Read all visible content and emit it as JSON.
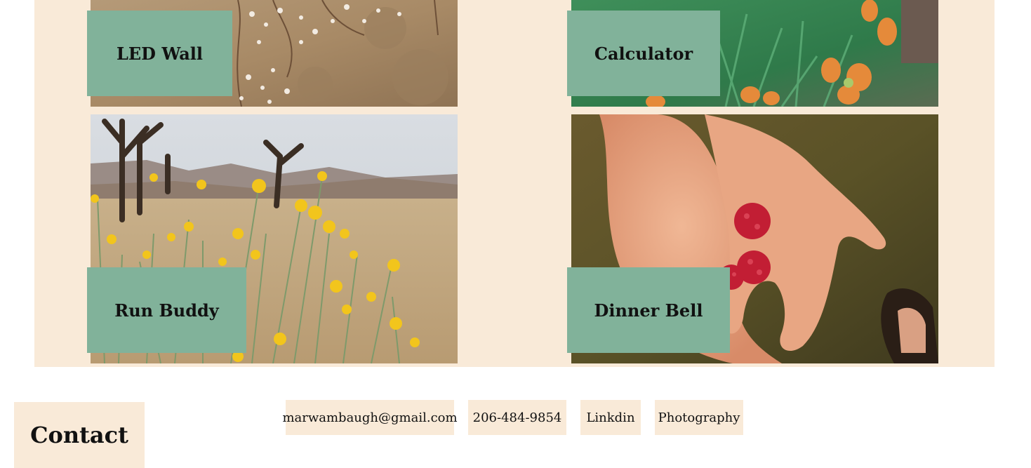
{
  "projects": [
    {
      "title": "LED Wall",
      "image": "dry-ground-with-small-white-flowers"
    },
    {
      "title": "Calculator",
      "image": "orange-wildflowers-on-green-foliage"
    },
    {
      "title": "Run Buddy",
      "image": "yellow-desert-flowers-with-joshua-trees"
    },
    {
      "title": "Dinner Bell",
      "image": "open-hands-holding-raspberries"
    }
  ],
  "contact": {
    "heading": "Contact",
    "links": [
      {
        "label": "marwambaugh@gmail.com",
        "icon": "email"
      },
      {
        "label": "206-484-9854",
        "icon": "phone"
      },
      {
        "label": "Linkdin",
        "icon": "linkedin"
      },
      {
        "label": "Photography",
        "icon": "photography"
      }
    ]
  },
  "colors": {
    "cream": "#f9ead8",
    "sage": "#81b29a",
    "text": "#111111"
  }
}
